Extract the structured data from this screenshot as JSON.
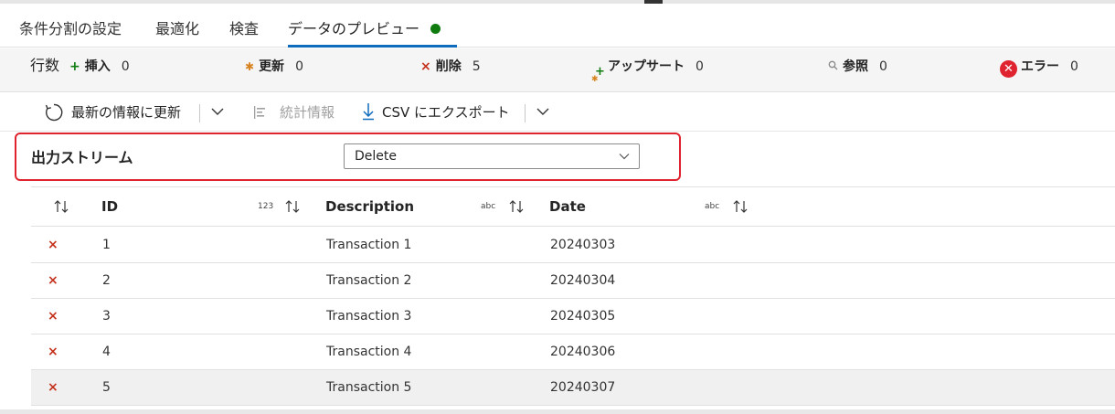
{
  "tabs": [
    {
      "label": "条件分割の設定"
    },
    {
      "label": "最適化"
    },
    {
      "label": "検査"
    },
    {
      "label": "データのプレビュー",
      "status_color": "#107c10"
    }
  ],
  "stats": {
    "rows_label": "行数",
    "insert": {
      "label": "挿入",
      "value": "0",
      "color": "#107c10",
      "icon": "plus-icon"
    },
    "update": {
      "label": "更新",
      "value": "0",
      "color": "#d78320",
      "icon": "asterisk-icon"
    },
    "delete": {
      "label": "削除",
      "value": "5",
      "color": "#c4311c",
      "icon": "x-icon"
    },
    "upsert": {
      "label": "アップサート",
      "value": "0",
      "color": "#107c10",
      "icon": "upsert-icon"
    },
    "lookup": {
      "label": "参照",
      "value": "0",
      "color": "#8a8a8a",
      "icon": "search-icon"
    },
    "error": {
      "label": "エラー",
      "value": "0",
      "color": "#e0242f",
      "icon": "error-circle-icon"
    }
  },
  "toolbar": {
    "refresh_label": "最新の情報に更新",
    "stats_label": "統計情報",
    "export_label": "CSV にエクスポート"
  },
  "stream": {
    "label": "出力ストリーム",
    "selected": "Delete"
  },
  "table": {
    "columns": [
      {
        "name": "ID",
        "type": "123"
      },
      {
        "name": "Description",
        "type": "abc"
      },
      {
        "name": "Date",
        "type": "abc"
      }
    ],
    "rows": [
      {
        "marker": "×",
        "id": "1",
        "description": "Transaction 1",
        "date": "20240303"
      },
      {
        "marker": "×",
        "id": "2",
        "description": "Transaction 2",
        "date": "20240304"
      },
      {
        "marker": "×",
        "id": "3",
        "description": "Transaction 3",
        "date": "20240305"
      },
      {
        "marker": "×",
        "id": "4",
        "description": "Transaction 4",
        "date": "20240306"
      },
      {
        "marker": "×",
        "id": "5",
        "description": "Transaction 5",
        "date": "20240307"
      }
    ]
  }
}
